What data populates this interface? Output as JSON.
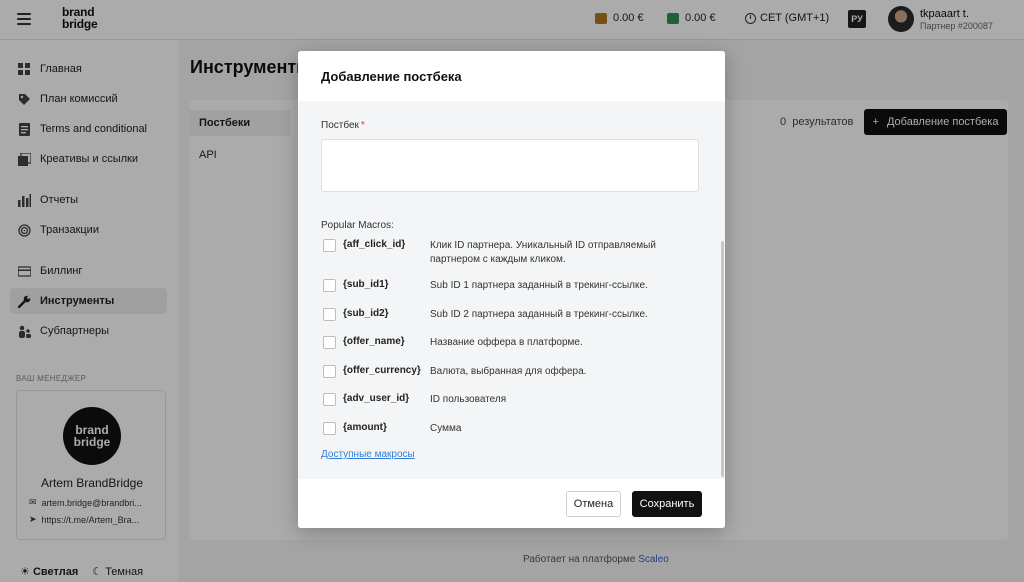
{
  "header": {
    "logo_line1": "brand",
    "logo_line2": "bridge",
    "balance1": "0.00 €",
    "balance2": "0.00 €",
    "timezone": "CET (GMT+1)",
    "language": "РУ",
    "user_name": "tkpaaart t.",
    "user_id": "Партнер #200087",
    "colors": {
      "balance1_icon": "#b07a22",
      "balance2_icon": "#2f8f4e"
    }
  },
  "sidebar": {
    "items": [
      {
        "label": "Главная",
        "icon": "grid-icon"
      },
      {
        "label": "План комиссий",
        "icon": "tag-icon"
      },
      {
        "label": "Terms and conditional",
        "icon": "document-icon"
      },
      {
        "label": "Креативы и ссылки",
        "icon": "images-icon"
      },
      {
        "label": "Отчеты",
        "icon": "bar-chart-icon"
      },
      {
        "label": "Транзакции",
        "icon": "fingerprint-icon"
      },
      {
        "label": "Биллинг",
        "icon": "card-icon"
      },
      {
        "label": "Инструменты",
        "icon": "wrench-icon"
      },
      {
        "label": "Субпартнеры",
        "icon": "users-icon"
      }
    ],
    "manager_title": "ВАШ МЕНЕДЖЕР",
    "manager_logo_line1": "brand",
    "manager_logo_line2": "bridge",
    "manager_name": "Artem BrandBridge",
    "manager_email": "artem.bridge@brandbri...",
    "manager_telegram": "https://t.me/Artem_Bra...",
    "theme_light": "Светлая",
    "theme_dark": "Темная"
  },
  "main": {
    "title": "Инструменты",
    "tabs": [
      "Постбеки",
      "API"
    ],
    "results_count": "0",
    "results_label": "результатов",
    "add_button": "Добавление постбека",
    "footer_text": "Работает на платформе",
    "footer_link": "Scaleo"
  },
  "modal": {
    "title": "Добавление постбека",
    "field_label": "Постбек",
    "required_mark": "*",
    "input_value": "",
    "macros_label": "Popular Macros:",
    "macros": [
      {
        "code": "{aff_click_id}",
        "desc": "Клик ID партнера. Уникальный ID отправляемый партнером с каждым кликом."
      },
      {
        "code": "{sub_id1}",
        "desc": "Sub ID 1 партнера заданный в трекинг-ссылке."
      },
      {
        "code": "{sub_id2}",
        "desc": "Sub ID 2 партнера заданный в трекинг-ссылке."
      },
      {
        "code": "{offer_name}",
        "desc": "Название оффера в платформе."
      },
      {
        "code": "{offer_currency}",
        "desc": "Валюта, выбранная для оффера."
      },
      {
        "code": "{adv_user_id}",
        "desc": "ID пользователя"
      },
      {
        "code": "{amount}",
        "desc": "Сумма"
      }
    ],
    "macros_link": "Доступные макросы",
    "cancel_label": "Отмена",
    "save_label": "Сохранить"
  }
}
